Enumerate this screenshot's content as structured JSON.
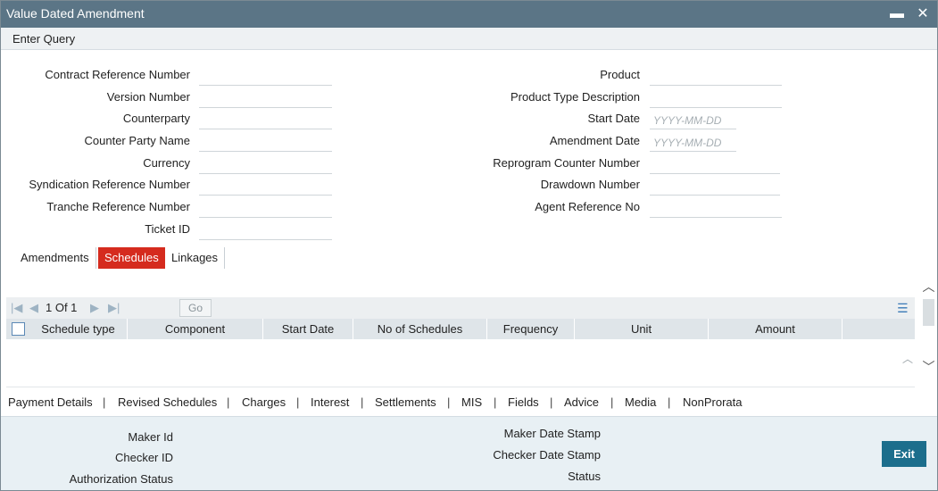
{
  "window": {
    "title": "Value Dated Amendment",
    "minimize": "▬",
    "close": "✕"
  },
  "menu": {
    "enter_query": "Enter Query"
  },
  "left_fields": [
    {
      "label": "Contract Reference Number",
      "value": ""
    },
    {
      "label": "Version Number",
      "value": ""
    },
    {
      "label": "Counterparty",
      "value": ""
    },
    {
      "label": "Counter Party Name",
      "value": ""
    },
    {
      "label": "Currency",
      "value": ""
    },
    {
      "label": "Syndication Reference Number",
      "value": ""
    },
    {
      "label": "Tranche Reference Number",
      "value": ""
    },
    {
      "label": "Ticket ID",
      "value": ""
    }
  ],
  "right_fields": [
    {
      "label": "Product",
      "value": "",
      "placeholder": ""
    },
    {
      "label": "Product Type Description",
      "value": "",
      "placeholder": ""
    },
    {
      "label": "Start Date",
      "value": "",
      "placeholder": "YYYY-MM-DD"
    },
    {
      "label": "Amendment Date",
      "value": "",
      "placeholder": "YYYY-MM-DD"
    },
    {
      "label": "Reprogram Counter Number",
      "value": "",
      "placeholder": ""
    },
    {
      "label": "Drawdown Number",
      "value": "",
      "placeholder": ""
    },
    {
      "label": "Agent Reference No",
      "value": "",
      "placeholder": ""
    }
  ],
  "tabs": [
    {
      "label": "Amendments",
      "active": false
    },
    {
      "label": "Schedules",
      "active": true
    },
    {
      "label": "Linkages",
      "active": false
    }
  ],
  "pager": {
    "page_text": "1 Of 1",
    "go_label": "Go"
  },
  "grid": {
    "columns": [
      "Schedule type",
      "Component",
      "Start Date",
      "No of Schedules",
      "Frequency",
      "Unit",
      "Amount"
    ]
  },
  "subsystems": [
    "Payment Details",
    "Revised Schedules",
    "Charges",
    "Interest",
    "Settlements",
    "MIS",
    "Fields",
    "Advice",
    "Media",
    "NonProrata"
  ],
  "subsystem_separator": "|",
  "footer": {
    "maker_id": "Maker Id",
    "checker_id": "Checker ID",
    "authorization_status": "Authorization Status",
    "maker_date_stamp": "Maker Date Stamp",
    "checker_date_stamp": "Checker Date Stamp",
    "status": "Status",
    "exit_label": "Exit"
  },
  "colors": {
    "titlebar": "#5b7586",
    "active_tab": "#d52b1e",
    "exit_button": "#1c6e8c",
    "footer_bg": "#e8f0f4"
  }
}
